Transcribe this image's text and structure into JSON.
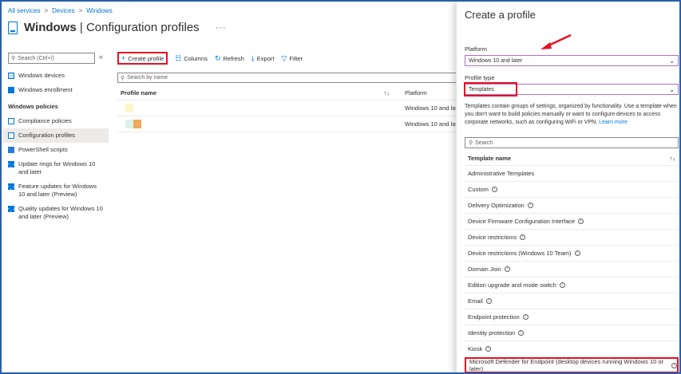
{
  "breadcrumb": [
    "All services",
    "Devices",
    "Windows"
  ],
  "title": {
    "bold": "Windows",
    "rest": "| Configuration profiles",
    "more": "···"
  },
  "nav": {
    "search_placeholder": "Search (Ctrl+/)",
    "collapse": "«",
    "top_items": [
      {
        "label": "Windows devices",
        "icon": "monitor-icon"
      },
      {
        "label": "Windows enrollment",
        "icon": "enrollment-icon"
      }
    ],
    "section": "Windows policies",
    "items": [
      {
        "label": "Compliance policies",
        "icon": "document-icon",
        "active": false
      },
      {
        "label": "Configuration profiles",
        "icon": "document-icon",
        "active": true
      },
      {
        "label": "PowerShell scripts",
        "icon": "powershell-icon",
        "active": false
      },
      {
        "label": "Update rings for Windows 10 and later",
        "icon": "windows-logo-icon",
        "active": false
      },
      {
        "label": "Feature updates for Windows 10 and later (Preview)",
        "icon": "windows-logo-icon",
        "active": false
      },
      {
        "label": "Quality updates for Windows 10 and later (Preview)",
        "icon": "windows-logo-icon",
        "active": false
      }
    ]
  },
  "toolbar": {
    "create": "Create profile",
    "columns": "Columns",
    "refresh": "Refresh",
    "export": "Export",
    "filter": "Filter"
  },
  "main": {
    "search_placeholder": "Search by name",
    "col_name": "Profile name",
    "col_platform": "Platform",
    "sort": "↑↓",
    "rows": [
      {
        "platform": "Windows 10 and later",
        "swatches": [
          "#fdf6c9"
        ]
      },
      {
        "platform": "Windows 10 and later",
        "swatches": [
          "#dff1ee",
          "#f0a95c"
        ]
      }
    ]
  },
  "panel": {
    "title": "Create a profile",
    "platform_label": "Platform",
    "platform_value": "Windows 10 and later",
    "profile_type_label": "Profile type",
    "profile_type_value": "Templates",
    "description": "Templates contain groups of settings, organized by functionality. Use a template when you don't want to build policies manually or want to configure devices to access corporate networks, such as configuring WiFi or VPN.",
    "learn_more": "Learn more",
    "search_placeholder": "Search",
    "list_header": "Template name",
    "list_sort": "↑↓",
    "templates": [
      {
        "name": "Administrative Templates",
        "info": false
      },
      {
        "name": "Custom",
        "info": true
      },
      {
        "name": "Delivery Optimization",
        "info": true
      },
      {
        "name": "Device Firmware Configuration Interface",
        "info": true
      },
      {
        "name": "Device restrictions",
        "info": true
      },
      {
        "name": "Device restrictions (Windows 10 Team)",
        "info": true
      },
      {
        "name": "Domain Join",
        "info": true
      },
      {
        "name": "Edition upgrade and mode switch",
        "info": true
      },
      {
        "name": "Email",
        "info": true
      },
      {
        "name": "Endpoint protection",
        "info": true
      },
      {
        "name": "Identity protection",
        "info": true
      },
      {
        "name": "Kiosk",
        "info": true
      },
      {
        "name": "Microsoft Defender for Endpoint (desktop devices running Windows 10 or later)",
        "info": true
      }
    ]
  },
  "colors": {
    "accent": "#0078d4",
    "highlight": "#e81123"
  }
}
